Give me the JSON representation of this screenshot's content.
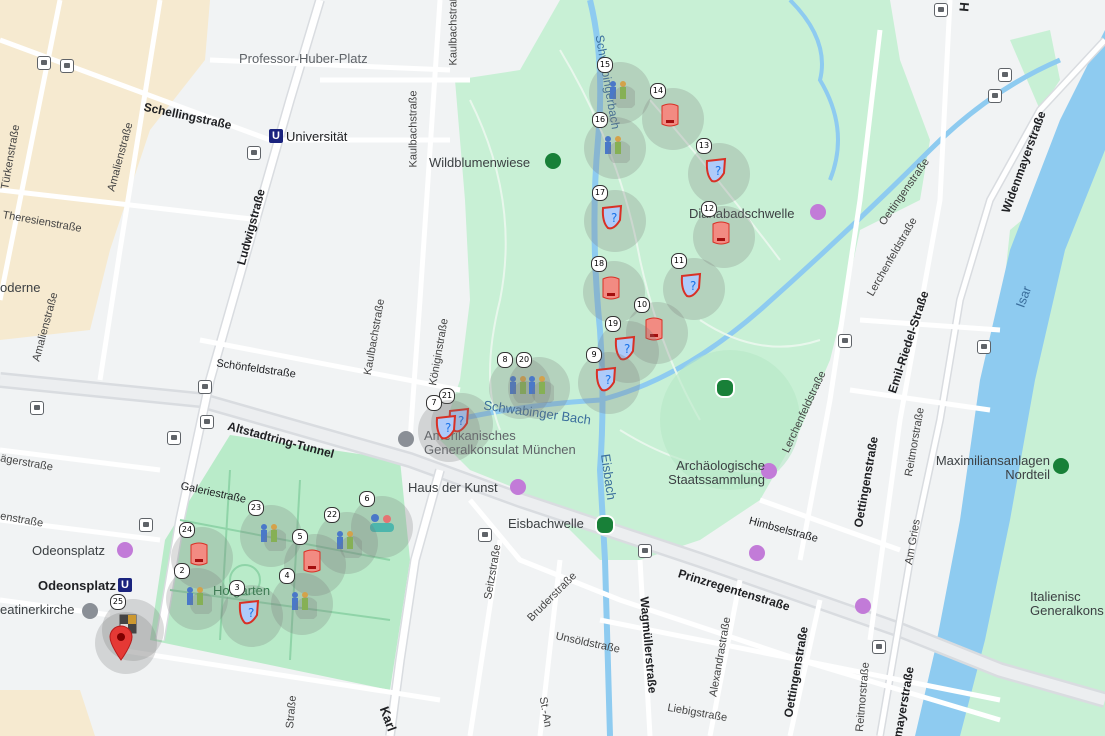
{
  "colors": {
    "park": "#c8f0d5",
    "park_dark": "#a8e6c0",
    "water": "#8ecbf0",
    "road": "#ffffff",
    "road_major": "#dcdfe3",
    "campus": "#f6ead0",
    "pin": "#e53935"
  },
  "labels": {
    "professor_huber_platz": "Professor-Huber-Platz",
    "schellingstrasse": "Schellingstraße",
    "universitaet": "Universität",
    "kaulbachstrasse_top": "Kaulbachstraße",
    "kaulbachstrasse_mid": "Kaulbachstraße",
    "kaulbachstrasse_low": "Kaulbachstraße",
    "wildblumenwiese": "Wildblumenwiese",
    "schwabingerbach_top": "Schwabingerbach",
    "schwabinger_bach": "Schwabinger Bach",
    "dianabadschwelle": "Dianabadschwelle",
    "turkenstrasse": "Türkenstraße",
    "amalienstrasse": "Amalienstraße",
    "amalienstrasse2": "Amalienstraße",
    "theresienstrasse": "Theresienstraße",
    "ludwigstrasse": "Ludwigstraße",
    "moderne": "oderne",
    "schoenfeldstrasse": "Schönfeldstraße",
    "koeniginstrasse": "Königinstraße",
    "altstadtring_tunnel": "Altstadtring-Tunnel",
    "amerikanisches_generalkonsulat": "Amerikanisches Generalkonsulat München",
    "haus_der_kunst": "Haus der Kunst",
    "eisbach": "Eisbach",
    "eisbachwelle": "Eisbachwelle",
    "archaeologische": "Archäologische Staatssammlung",
    "galeriestrasse": "Galeriestraße",
    "odeonsplatz": "Odeonsplatz",
    "odeonsplatz_u": "Odeonsplatz",
    "theatinerkirche": "eatinerkirche",
    "hofgarten": "Hofgarten",
    "jaegerstrasse": "ägerstraße",
    "ensstrasse": "enstraße",
    "seitzstrasse": "Seitzstraße",
    "bruderstrasse": "Bruderstraße",
    "unsoeldstrasse": "Unsöldstraße",
    "wagmuellerstrasse": "Wagmüllerstraße",
    "alexandrastrasse": "Alexandrastraße",
    "prinzregentenstrasse": "Prinzregentenstraße",
    "liebigstrasse": "Liebigstraße",
    "oettingenstrasse_low": "Oettingenstraße",
    "oettingenstrasse_mid": "Oettingenstraße",
    "oettingenstrasse_top": "Oettingenstraße",
    "himbselstrasse": "Himbselstraße",
    "lerchenfeldstrasse": "Lerchenfeldstraße",
    "lerchenfeldstrasse2": "Lerchenfeldstraße",
    "emil_riedel": "Emil-Riedel-Straße",
    "widenmayerstrasse": "Widenmayerstraße",
    "widenmayerstrasse2": "mayerstraße",
    "isar": "Isar",
    "reitmorstrasse": "Reitmorstraße",
    "reitmorstrasse2": "Reitmorstraße",
    "am_gries": "Am Gries",
    "maximiliansanlagen": "Maximiliansanlagen Nordteil",
    "italienisches": "Italienisc Generalkons",
    "karl": "Karl",
    "st_an": "St.-An",
    "strasse_low": "Straße",
    "h_top": "H"
  },
  "markers": [
    {
      "n": "15",
      "type": "people"
    },
    {
      "n": "14",
      "type": "fire"
    },
    {
      "n": "16",
      "type": "people"
    },
    {
      "n": "13",
      "type": "shield"
    },
    {
      "n": "17",
      "type": "shield"
    },
    {
      "n": "12",
      "type": "fire"
    },
    {
      "n": "18",
      "type": "fire"
    },
    {
      "n": "11",
      "type": "shield"
    },
    {
      "n": "10",
      "type": "fire"
    },
    {
      "n": "19",
      "type": "shield"
    },
    {
      "n": "9",
      "type": "shield"
    },
    {
      "n": "8",
      "type": "people"
    },
    {
      "n": "20",
      "type": "people"
    },
    {
      "n": "21",
      "type": "shield"
    },
    {
      "n": "7",
      "type": "shield"
    },
    {
      "n": "6",
      "type": "group"
    },
    {
      "n": "23",
      "type": "people"
    },
    {
      "n": "22",
      "type": "people"
    },
    {
      "n": "24",
      "type": "fire"
    },
    {
      "n": "5",
      "type": "fire"
    },
    {
      "n": "2",
      "type": "people"
    },
    {
      "n": "4",
      "type": "people"
    },
    {
      "n": "3",
      "type": "shield"
    },
    {
      "n": "25",
      "type": "flag"
    }
  ]
}
